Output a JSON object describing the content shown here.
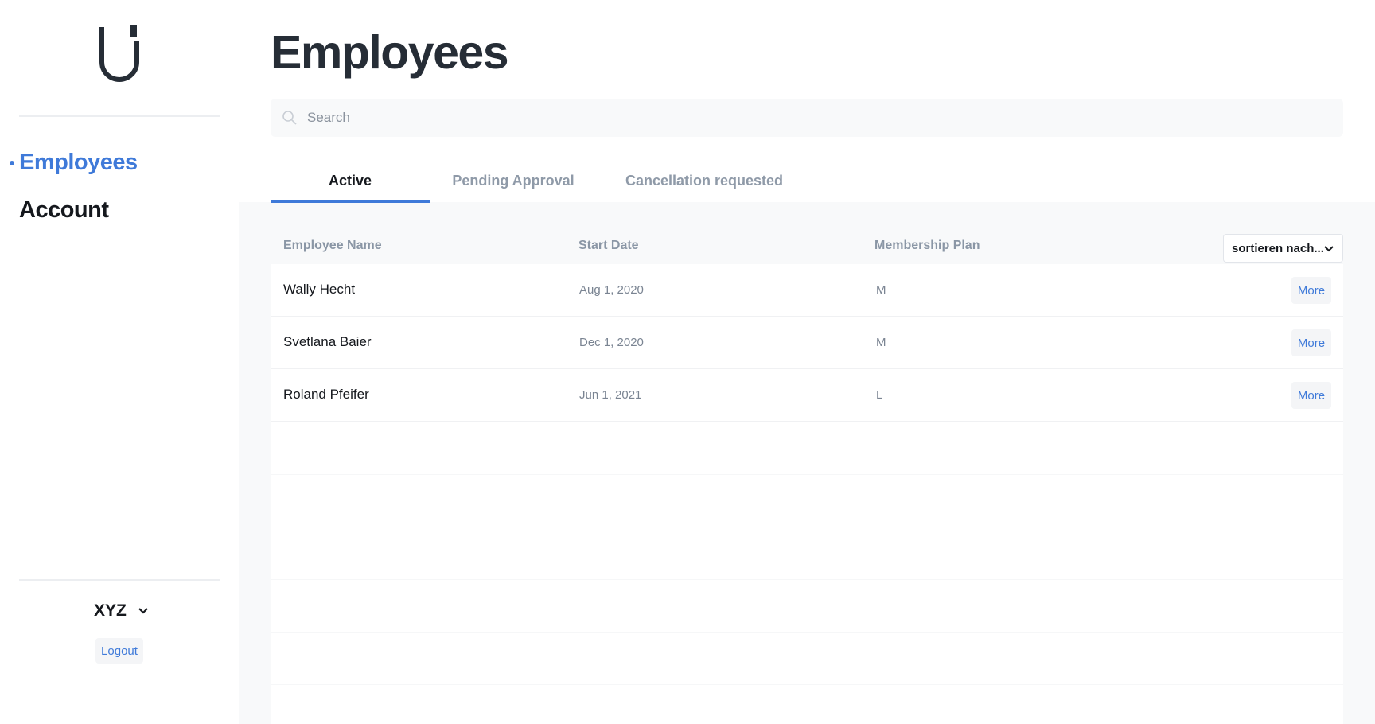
{
  "sidebar": {
    "logo": "logo-icon",
    "nav": [
      {
        "label": "Employees",
        "active": true
      },
      {
        "label": "Account",
        "active": false
      }
    ],
    "account_name": "XYZ",
    "logout_label": "Logout"
  },
  "main": {
    "title": "Employees",
    "search": {
      "placeholder": "Search",
      "value": ""
    },
    "tabs": [
      {
        "label": "Active",
        "active": true
      },
      {
        "label": "Pending Approval",
        "active": false
      },
      {
        "label": "Cancellation requested",
        "active": false
      }
    ],
    "table": {
      "columns": [
        "Employee Name",
        "Start Date",
        "Membership Plan"
      ],
      "sort_label": "sortieren nach...",
      "rows": [
        {
          "name": "Wally Hecht",
          "start_date": "Aug 1, 2020",
          "plan": "M",
          "action": "More"
        },
        {
          "name": "Svetlana Baier",
          "start_date": "Dec 1, 2020",
          "plan": "M",
          "action": "More"
        },
        {
          "name": "Roland Pfeifer",
          "start_date": "Jun 1, 2021",
          "plan": "L",
          "action": "More"
        }
      ]
    }
  },
  "colors": {
    "accent": "#3f7ad9",
    "title": "#262d36",
    "muted": "#8a96a5",
    "panel_bg": "#f8f9fa"
  }
}
